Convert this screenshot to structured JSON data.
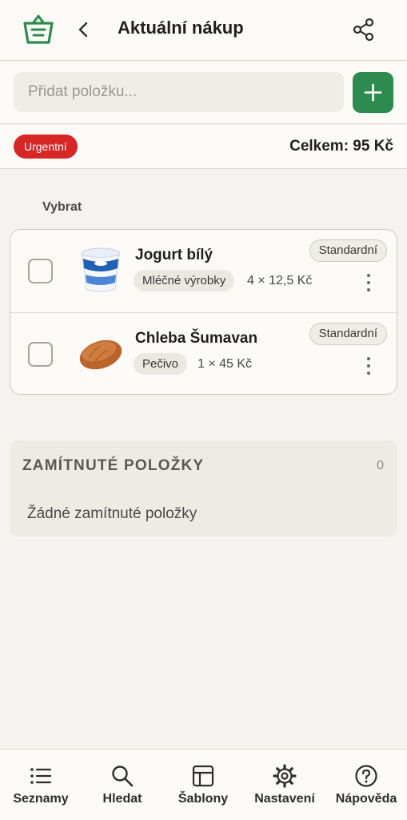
{
  "header": {
    "title": "Aktuální nákup",
    "logo_icon": "shopping-basket-icon",
    "back_icon": "chevron-left-icon",
    "share_icon": "share-icon",
    "accent_color": "#2e8b4f"
  },
  "add_item": {
    "placeholder": "Přidat položku...",
    "value": "",
    "button_icon": "plus-icon"
  },
  "summary": {
    "priority_badge": "Urgentní",
    "priority_color": "#d72626",
    "total": "Celkem: 95 Kč"
  },
  "list": {
    "select_label": "Vybrat",
    "items": [
      {
        "name": "Jogurt bílý",
        "category": "Mléčné výrobky",
        "quantity_price": "4 × 12,5 Kč",
        "type": "Standardní",
        "checked": false,
        "image_icon": "yogurt-cup-icon"
      },
      {
        "name": "Chleba Šumavan",
        "category": "Pečivo",
        "quantity_price": "1 × 45 Kč",
        "type": "Standardní",
        "checked": false,
        "image_icon": "bread-loaf-icon"
      }
    ]
  },
  "rejected": {
    "title": "ZAMÍTNUTÉ POLOŽKY",
    "count": "0",
    "empty_text": "Žádné zamítnuté položky"
  },
  "bottom_nav": [
    {
      "label": "Seznamy",
      "icon": "list-icon"
    },
    {
      "label": "Hledat",
      "icon": "search-icon"
    },
    {
      "label": "Šablony",
      "icon": "template-icon"
    },
    {
      "label": "Nastavení",
      "icon": "gear-icon"
    },
    {
      "label": "Nápověda",
      "icon": "help-icon"
    }
  ]
}
